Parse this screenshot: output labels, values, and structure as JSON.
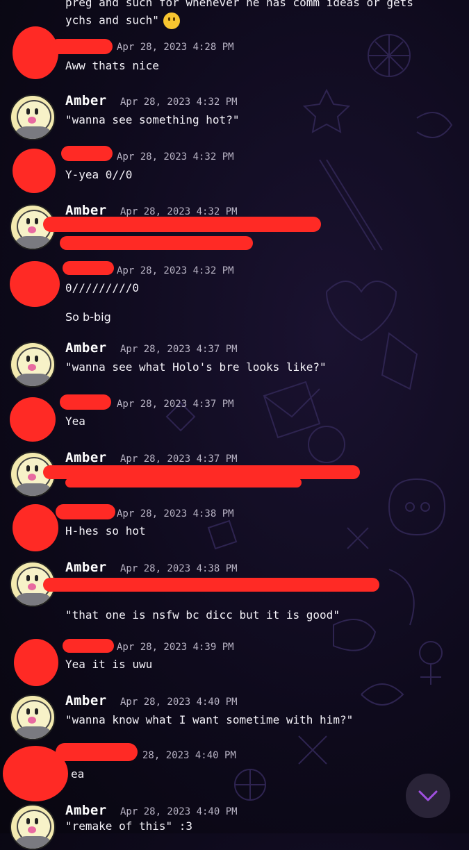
{
  "top_message": {
    "line1": "preg and such for whenever he has comm ideas or gets",
    "line2": "ychs and such\""
  },
  "messages": [
    {
      "sender": "",
      "time": "Apr 28, 2023 4:28 PM",
      "lines": [
        "Aww thats nice"
      ]
    },
    {
      "sender": "Amber",
      "time": "Apr 28, 2023 4:32 PM",
      "lines": [
        "\"wanna see something hot?\""
      ]
    },
    {
      "sender": "",
      "time": "Apr 28, 2023 4:32 PM",
      "lines": [
        "Y-yea 0//0"
      ]
    },
    {
      "sender": "Amber",
      "time": "Apr 28, 2023 4:32 PM",
      "lines": []
    },
    {
      "sender": "",
      "time": "Apr 28, 2023 4:32 PM",
      "lines": [
        "0/////////0",
        "So b-big"
      ]
    },
    {
      "sender": "Amber",
      "time": "Apr 28, 2023 4:37 PM",
      "lines": [
        "\"wanna see what Holo's bre looks like?\""
      ]
    },
    {
      "sender": "",
      "time": "Apr 28, 2023 4:37 PM",
      "lines": [
        "Yea"
      ]
    },
    {
      "sender": "Amber",
      "time": "Apr 28, 2023 4:37 PM",
      "lines": []
    },
    {
      "sender": "",
      "time": "Apr 28, 2023 4:38 PM",
      "lines": [
        "H-hes so hot"
      ]
    },
    {
      "sender": "Amber",
      "time": "Apr 28, 2023 4:38 PM",
      "lines": [
        "\"that one is nsfw bc dicc but it is good\""
      ]
    },
    {
      "sender": "",
      "time": "Apr 28, 2023 4:39 PM",
      "lines": [
        "Yea it is uwu"
      ]
    },
    {
      "sender": "Amber",
      "time": "Apr 28, 2023 4:40 PM",
      "lines": [
        "\"wanna know what I want sometime with him?\""
      ]
    },
    {
      "sender": "",
      "time": "28, 2023 4:40 PM",
      "lines": [
        "ea"
      ]
    },
    {
      "sender": "Amber",
      "time": "Apr 28, 2023 4:40 PM",
      "lines": [
        "\"remake of this\" :3"
      ]
    }
  ],
  "icons": {
    "scroll_down": "chevron-down-icon",
    "emoji": "slightly-smiling-face-icon"
  },
  "colors": {
    "background": "#0e0a1c",
    "redaction": "#ff2a25",
    "timestamp": "#b8b3c4",
    "scroll_button": "#2a2438",
    "chevron": "#a050e0"
  }
}
